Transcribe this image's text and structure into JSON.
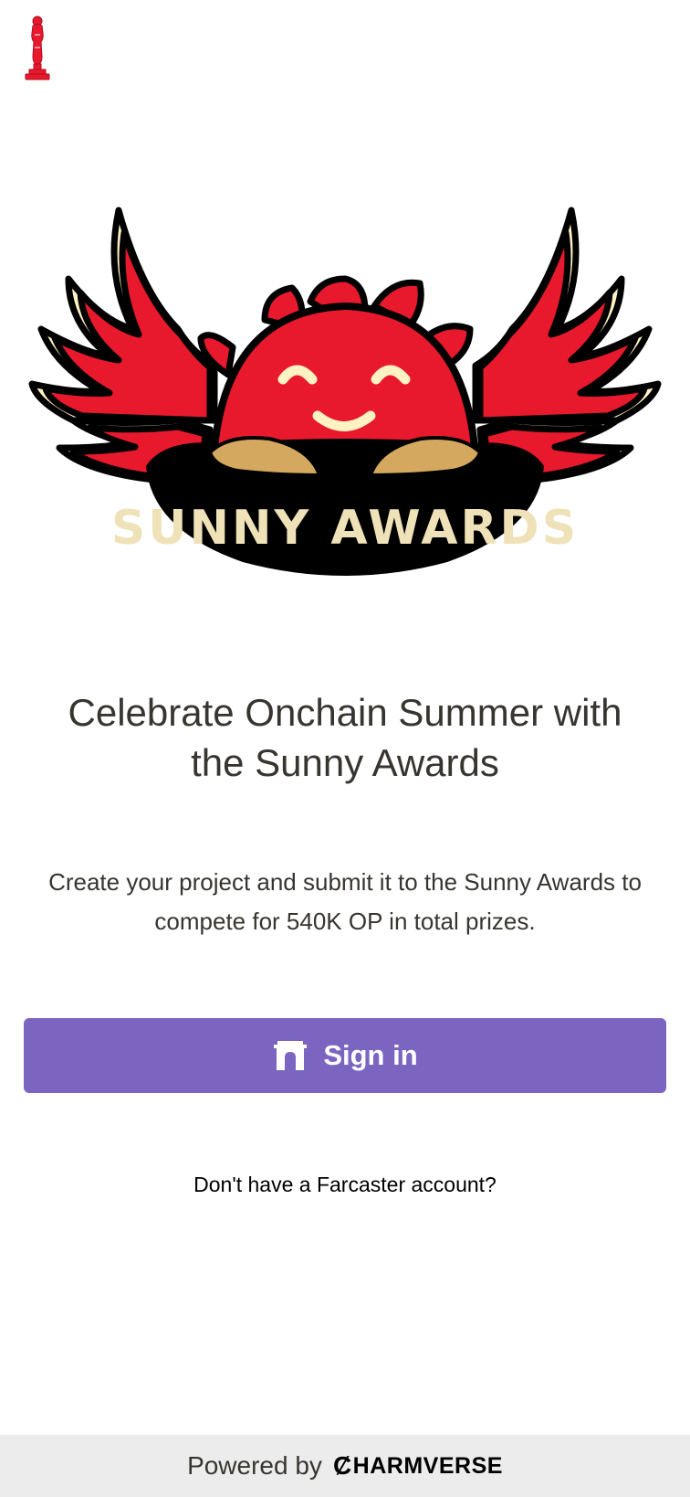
{
  "app": {
    "home_icon": "trophy-statue-icon",
    "brand_color": "#e01e35"
  },
  "hero": {
    "image": "sunny-awards-logo",
    "logo_text": "SUNNY AWARDS"
  },
  "main": {
    "headline": "Celebrate Onchain Summer with the Sunny Awards",
    "description": "Create your project and submit it to the Sunny Awards to compete for 540K OP in total prizes."
  },
  "signin": {
    "label": "Sign in",
    "icon": "farcaster-icon",
    "color": "#7c65c1"
  },
  "no_account": {
    "label": "Don't have a Farcaster account?"
  },
  "footer": {
    "powered_by": "Powered by",
    "brand_mark": "Ȼ",
    "brand_name": "HARMVERSE"
  }
}
